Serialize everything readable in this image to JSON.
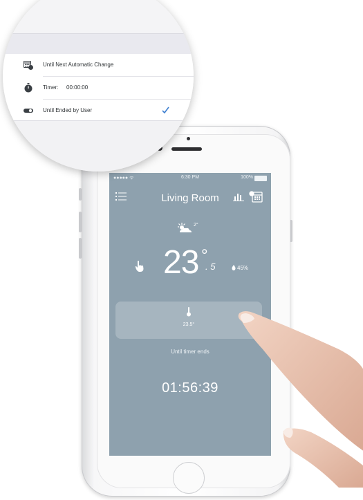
{
  "colors": {
    "screen_background": "#8ea1ae",
    "accent_check": "#3d7fd0",
    "list_text": "#2f3336"
  },
  "status_bar": {
    "signal": "●●●●● ᯤ",
    "time": "6:30 PM",
    "battery": "100%"
  },
  "header": {
    "title": "Living Room",
    "icons": [
      "menu-icon",
      "chart-icon",
      "schedule-icon"
    ]
  },
  "weather": {
    "icon": "partly-cloudy-icon",
    "outdoor_temp": "2°"
  },
  "current": {
    "temp_int": "23",
    "temp_degree": "°",
    "temp_decimal": ". 5",
    "humidity": "45%"
  },
  "setpoint": {
    "value": "23.5°",
    "until": "Until timer ends"
  },
  "timer": "01:56:39",
  "magnified_menu": {
    "items": [
      {
        "icon": "calendar-clock-icon",
        "label": "Until Next Automatic Change"
      },
      {
        "icon": "stopwatch-icon",
        "label": "Timer:",
        "value": "00:00:00"
      },
      {
        "icon": "toggle-icon",
        "label": "Until Ended by User",
        "selected": true
      }
    ]
  }
}
